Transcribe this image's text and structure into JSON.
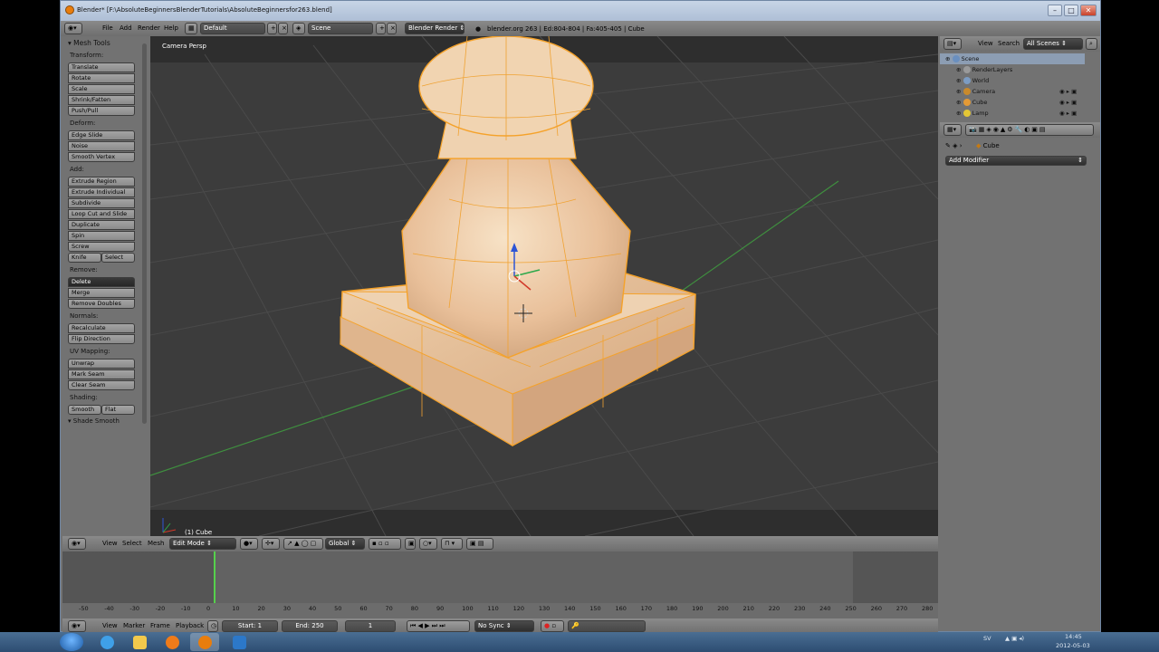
{
  "window": {
    "title": "Blender* [F:\\AbsoluteBeginnersBlenderTutorials\\AbsoluteBeginnersfor263.blend]"
  },
  "info_header": {
    "menus": [
      "File",
      "Add",
      "Render",
      "Help"
    ],
    "layout": "Default",
    "scene": "Scene",
    "engine": "Blender Render",
    "stats": "blender.org 263 | Ed:804-804 | Fa:405-405 | Cube"
  },
  "toolshelf": {
    "panel_title": "Mesh Tools",
    "sections": [
      {
        "label": "Transform:",
        "buttons": [
          "Translate",
          "Rotate",
          "Scale",
          "Shrink/Fatten",
          "Push/Pull"
        ]
      },
      {
        "label": "Deform:",
        "buttons": [
          "Edge Slide",
          "Noise",
          "Smooth Vertex"
        ]
      },
      {
        "label": "Add:",
        "buttons": [
          "Extrude Region",
          "Extrude Individual",
          "Subdivide",
          "Loop Cut and Slide",
          "Duplicate",
          "Spin",
          "Screw"
        ]
      },
      {
        "label": "Remove:",
        "buttons": [
          "Delete",
          "Merge",
          "Remove Doubles"
        ]
      },
      {
        "label": "Normals:",
        "buttons": [
          "Recalculate",
          "Flip Direction"
        ]
      },
      {
        "label": "UV Mapping:",
        "buttons": [
          "Unwrap",
          "Mark Seam",
          "Clear Seam"
        ]
      },
      {
        "label": "Shading:",
        "buttons": []
      }
    ],
    "knife": "Knife",
    "select": "Select",
    "smooth": "Smooth",
    "flat": "Flat",
    "shade_smooth": "Shade Smooth"
  },
  "viewport": {
    "label": "Camera Persp",
    "object_label": "(1) Cube"
  },
  "view3d_header": {
    "menus": [
      "View",
      "Select",
      "Mesh"
    ],
    "mode": "Edit Mode",
    "orientation": "Global"
  },
  "timeline": {
    "ticks": [
      "-50",
      "-40",
      "-30",
      "-20",
      "-10",
      "0",
      "10",
      "20",
      "30",
      "40",
      "50",
      "60",
      "70",
      "80",
      "90",
      "100",
      "110",
      "120",
      "130",
      "140",
      "150",
      "160",
      "170",
      "180",
      "190",
      "200",
      "210",
      "220",
      "230",
      "240",
      "250",
      "260",
      "270",
      "280"
    ],
    "current_frame_tick": "0",
    "menus": [
      "View",
      "Marker",
      "Frame",
      "Playback"
    ],
    "start": "Start: 1",
    "end": "End: 250",
    "current": "1",
    "sync": "No Sync"
  },
  "outliner": {
    "menus": [
      "View",
      "Search"
    ],
    "filter": "All Scenes",
    "rows": [
      {
        "label": "Scene",
        "color": "#6a8fbf"
      },
      {
        "label": "RenderLayers",
        "color": "#9a9a9a"
      },
      {
        "label": "World",
        "color": "#7c9cc3"
      },
      {
        "label": "Camera",
        "color": "#c98a2c"
      },
      {
        "label": "Cube",
        "color": "#e49a35"
      },
      {
        "label": "Lamp",
        "color": "#e4c735"
      }
    ]
  },
  "properties": {
    "object": "Cube",
    "add_modifier": "Add Modifier"
  },
  "taskbar": {
    "lang": "SV",
    "time": "14:45",
    "date": "2012-05-03"
  }
}
